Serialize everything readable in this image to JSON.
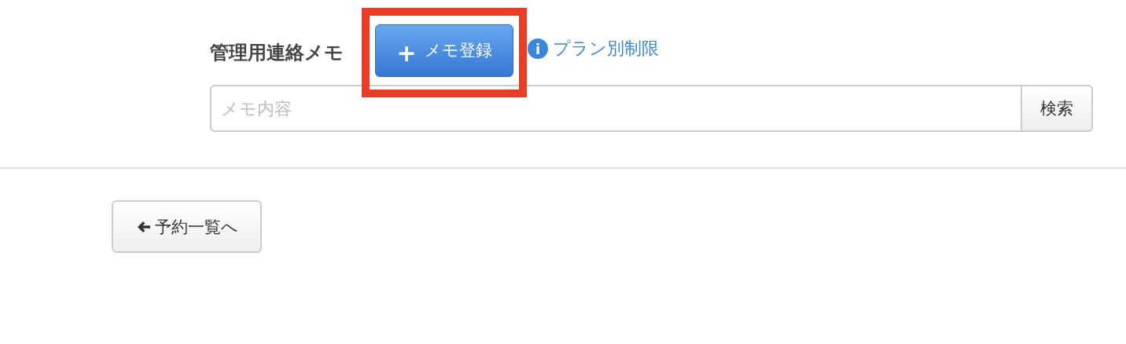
{
  "memo_section": {
    "title": "管理用連絡メモ",
    "add_button": {
      "icon": "+",
      "label": "メモ登録",
      "highlighted": true
    },
    "plan_limit_link": {
      "icon": "i",
      "label": "プラン別制限"
    },
    "search": {
      "placeholder": "メモ内容",
      "button": "検索"
    }
  },
  "back_button": {
    "label": "予約一覧へ"
  }
}
